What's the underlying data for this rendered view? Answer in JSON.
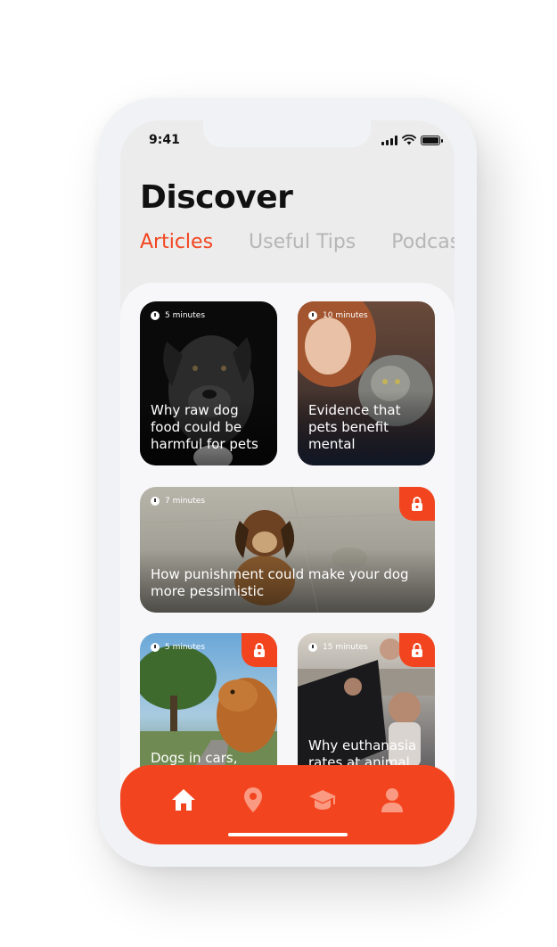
{
  "status_bar": {
    "time": "9:41"
  },
  "header": {
    "title": "Discover"
  },
  "tabs": [
    {
      "label": "Articles",
      "active": true
    },
    {
      "label": "Useful Tips",
      "active": false
    },
    {
      "label": "Podcast",
      "active": false
    }
  ],
  "articles": [
    {
      "duration": "5 minutes",
      "title": "Why raw dog food could be harmful for pets",
      "locked": false
    },
    {
      "duration": "10 minutes",
      "title": "Evidence that pets benefit mental",
      "locked": false
    },
    {
      "duration": "7 minutes",
      "title": "How punishment could make your dog more pessimistic",
      "locked": true
    },
    {
      "duration": "5 minutes",
      "title": "Dogs in cars,",
      "locked": true
    },
    {
      "duration": "15 minutes",
      "title": "Why euthanasia rates at animal",
      "locked": true
    }
  ],
  "bottom_nav": [
    {
      "icon": "home-icon",
      "active": true
    },
    {
      "icon": "location-pin-icon",
      "active": false
    },
    {
      "icon": "graduation-cap-icon",
      "active": false
    },
    {
      "icon": "user-icon",
      "active": false
    }
  ],
  "colors": {
    "accent": "#f2451f",
    "tab_inactive": "#b6b6b6",
    "title": "#111111"
  }
}
